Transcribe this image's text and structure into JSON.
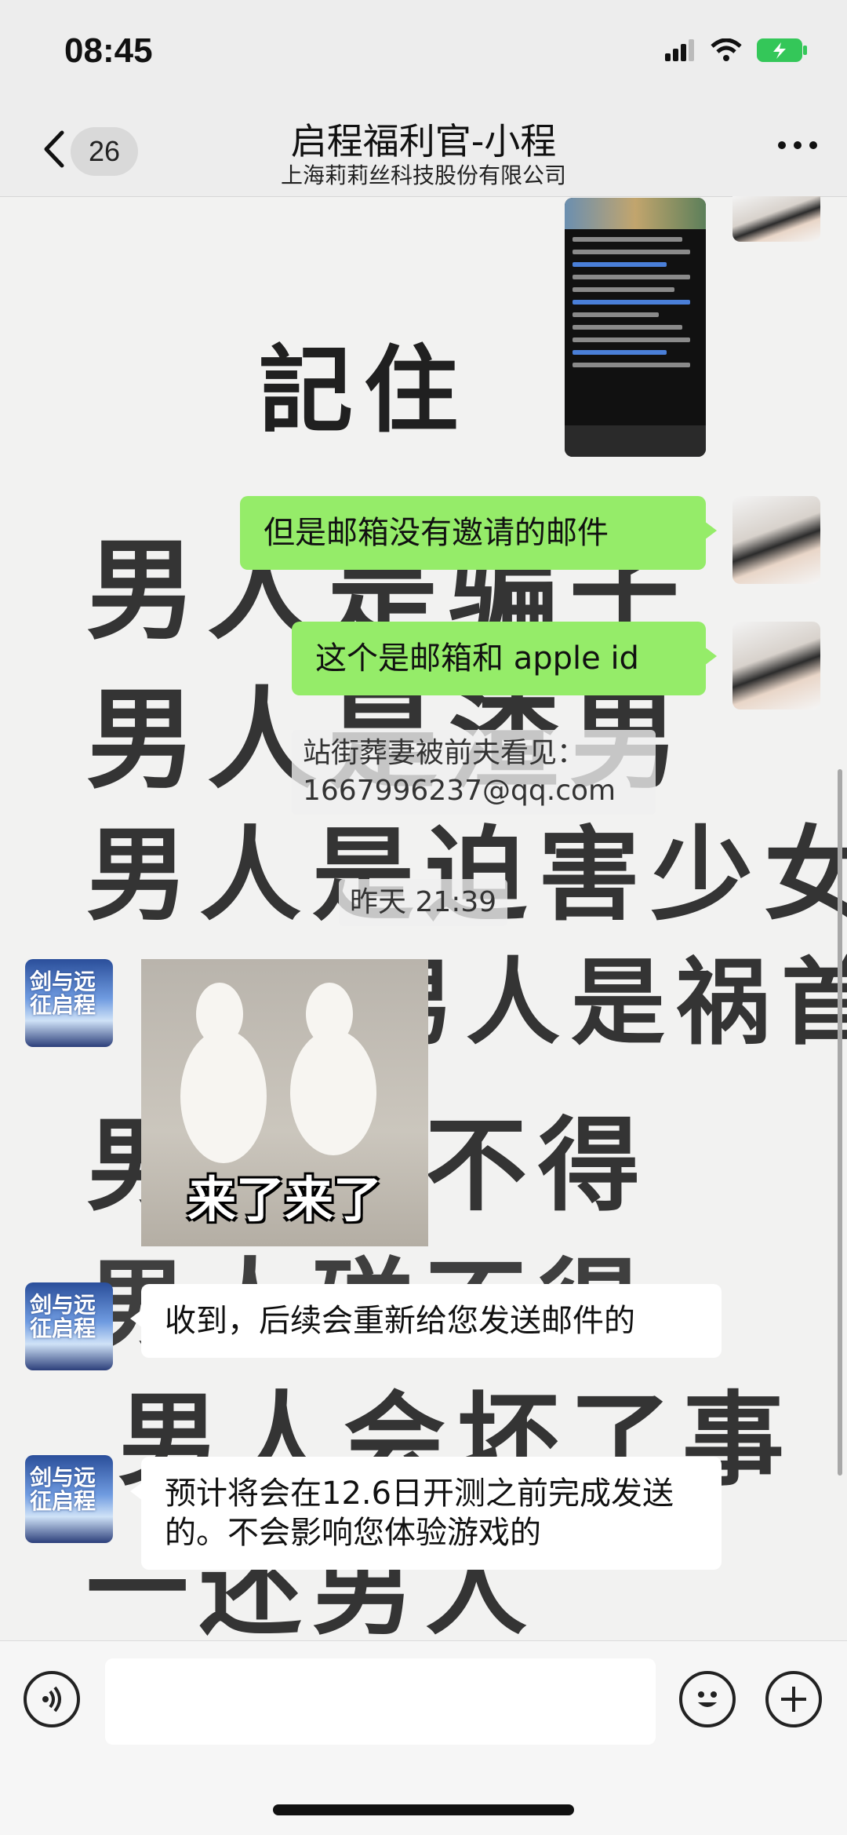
{
  "status_bar": {
    "time": "08:45",
    "battery_color": "#34c759"
  },
  "nav": {
    "back_count": "26",
    "title": "启程福利官-小程",
    "subtitle": "上海莉莉丝科技股份有限公司"
  },
  "wallpaper": {
    "lines": [
      "記住",
      "男人是骗子",
      "男人是渣男",
      "男人是迫害少女",
      "男人是祸首",
      "男人碰不得",
      "男人碰不得",
      "男人会坏了事",
      "一还男人"
    ]
  },
  "messages": {
    "m1": "但是邮箱没有邀请的邮件",
    "m2": "这个是邮箱和 apple id",
    "m3_line1": "站街葬妻被前夫看见：",
    "m3_line2": "1667996237@qq.com",
    "timestamp": "昨天 21:39",
    "sticker_text": "来了来了",
    "r1": "收到，后续会重新给您发送邮件的",
    "r2": "预计将会在12.6日开测之前完成发送的。不会影响您体验游戏的"
  },
  "game_avatar_text": "剑与远征启程",
  "input": {
    "placeholder": ""
  },
  "icons": [
    "back-chevron-icon",
    "more-icon",
    "voice-icon",
    "emoji-icon",
    "plus-icon",
    "signal-icon",
    "wifi-icon",
    "battery-icon"
  ]
}
